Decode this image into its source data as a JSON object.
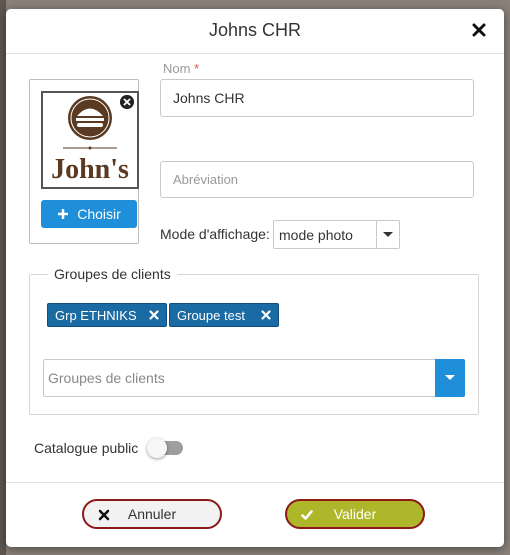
{
  "dialog": {
    "title": "Johns CHR"
  },
  "form": {
    "name_label": "Nom",
    "name_required_mark": "*",
    "name_value": "Johns CHR",
    "abbreviation_placeholder": "Abréviation",
    "abbreviation_value": "",
    "display_mode_label": "Mode d'affichage:",
    "display_mode_value": "mode photo"
  },
  "photo": {
    "logo_text": "John's",
    "choose_label": "Choisir"
  },
  "client_groups": {
    "legend": "Groupes de clients",
    "tags": [
      "Grp ETHNIKS",
      "Groupe test"
    ],
    "search_placeholder": "Groupes de clients"
  },
  "public_catalog": {
    "label": "Catalogue public",
    "enabled": false
  },
  "footer": {
    "cancel_label": "Annuler",
    "confirm_label": "Valider"
  },
  "colors": {
    "primary_blue": "#1f8fd9",
    "tag_blue": "#1a6aa3",
    "confirm_olive": "#aeb62a",
    "button_border": "#8b1a1a",
    "logo_brown": "#5a3a22"
  },
  "icons": {
    "close": "close-icon",
    "plus": "plus-icon",
    "remove": "remove-icon",
    "cancel": "x-icon",
    "confirm": "check-icon",
    "dropdown": "chevron-down-icon"
  }
}
